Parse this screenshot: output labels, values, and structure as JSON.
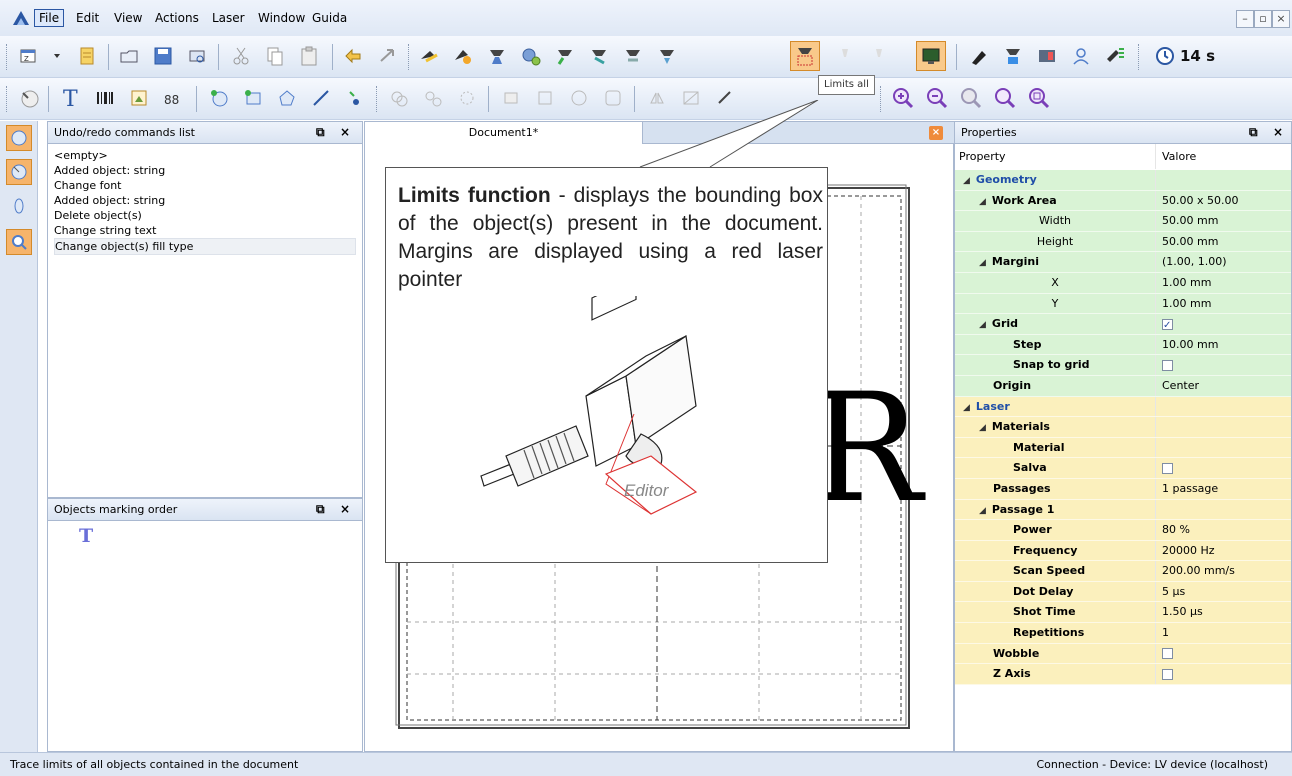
{
  "menu": {
    "items": [
      {
        "label": "File",
        "active": true
      },
      {
        "label": "Edit"
      },
      {
        "label": "View"
      },
      {
        "label": "Actions"
      },
      {
        "label": "Laser"
      },
      {
        "label": "Window"
      },
      {
        "label": "Guida"
      }
    ]
  },
  "toolbar": {
    "timer_label": "14 s",
    "tooltip": "Limits all"
  },
  "undo_panel": {
    "title": "Undo/redo commands list",
    "items": [
      "<empty>",
      "Added object: string",
      "Change font",
      "Added object: string",
      "Delete object(s)",
      "Change string text",
      "Change object(s) fill type"
    ]
  },
  "order_panel": {
    "title": "Objects marking order"
  },
  "document": {
    "tab_label": "Document1*",
    "canvas_letter": "R"
  },
  "callout": {
    "title": "Limits function",
    "text": " - displays the bounding box of the object(s) present in the document. Margins are displayed using a red laser pointer",
    "device_label": "Editor"
  },
  "properties": {
    "title": "Properties",
    "col_property": "Property",
    "col_value": "Valore",
    "rows": [
      {
        "indent": 0,
        "tri": true,
        "label": "Geometry",
        "value": "",
        "group": "geo",
        "style": "cat"
      },
      {
        "indent": 1,
        "tri": true,
        "label": "Work Area",
        "value": "50.00 x 50.00",
        "group": "geo",
        "style": "bold"
      },
      {
        "indent": 2,
        "tri": false,
        "label": "Width",
        "value": "50.00 mm",
        "group": "geo",
        "style": "center"
      },
      {
        "indent": 2,
        "tri": false,
        "label": "Height",
        "value": "50.00 mm",
        "group": "geo",
        "style": "center"
      },
      {
        "indent": 1,
        "tri": true,
        "label": "Margini",
        "value": "(1.00, 1.00)",
        "group": "geo",
        "style": "bold"
      },
      {
        "indent": 2,
        "tri": false,
        "label": "X",
        "value": "1.00 mm",
        "group": "geo",
        "style": "center"
      },
      {
        "indent": 2,
        "tri": false,
        "label": "Y",
        "value": "1.00 mm",
        "group": "geo",
        "style": "center"
      },
      {
        "indent": 1,
        "tri": true,
        "label": "Grid",
        "value": "",
        "check": true,
        "group": "geo",
        "style": "bold"
      },
      {
        "indent": 2,
        "tri": false,
        "label": "Step",
        "value": "10.00 mm",
        "group": "geo",
        "style": "bold"
      },
      {
        "indent": 2,
        "tri": false,
        "label": "Snap to grid",
        "value": "",
        "check": false,
        "group": "geo",
        "style": "bold"
      },
      {
        "indent": 1,
        "tri": false,
        "label": "Origin",
        "value": "Center",
        "group": "geo",
        "style": "bold"
      },
      {
        "indent": 0,
        "tri": true,
        "label": "Laser",
        "value": "",
        "group": "laser",
        "style": "cat"
      },
      {
        "indent": 1,
        "tri": true,
        "label": "Materials",
        "value": "",
        "group": "laser",
        "style": "bold"
      },
      {
        "indent": 2,
        "tri": false,
        "label": "Material",
        "value": "",
        "group": "laser",
        "style": "bold"
      },
      {
        "indent": 2,
        "tri": false,
        "label": "Salva",
        "value": "",
        "check": false,
        "group": "laser",
        "style": "bold"
      },
      {
        "indent": 1,
        "tri": false,
        "label": "Passages",
        "value": "1 passage",
        "group": "laser",
        "style": "bold"
      },
      {
        "indent": 1,
        "tri": true,
        "label": "Passage 1",
        "value": "",
        "group": "laser",
        "style": "bold"
      },
      {
        "indent": 2,
        "tri": false,
        "label": "Power",
        "value": "80 %",
        "group": "laser",
        "style": "bold"
      },
      {
        "indent": 2,
        "tri": false,
        "label": "Frequency",
        "value": "20000 Hz",
        "group": "laser",
        "style": "bold"
      },
      {
        "indent": 2,
        "tri": false,
        "label": "Scan Speed",
        "value": "200.00 mm/s",
        "group": "laser",
        "style": "bold"
      },
      {
        "indent": 2,
        "tri": false,
        "label": "Dot Delay",
        "value": "5 µs",
        "group": "laser",
        "style": "bold"
      },
      {
        "indent": 2,
        "tri": false,
        "label": "Shot Time",
        "value": "1.50 µs",
        "group": "laser",
        "style": "bold"
      },
      {
        "indent": 2,
        "tri": false,
        "label": "Repetitions",
        "value": "1",
        "group": "laser",
        "style": "bold"
      },
      {
        "indent": 1,
        "tri": false,
        "label": "Wobble",
        "value": "",
        "check": false,
        "group": "laser",
        "style": "bold"
      },
      {
        "indent": 1,
        "tri": false,
        "label": "Z Axis",
        "value": "",
        "check": false,
        "group": "laser",
        "style": "bold"
      }
    ]
  },
  "status": {
    "left": "Trace limits of all objects contained in the document",
    "right": "Connection - Device: LV device (localhost)"
  },
  "colors": {
    "accent": "#f6b46b",
    "geometry_bg": "#d9f3d5",
    "laser_bg": "#fbf0bd",
    "category_text": "#1f4ea8"
  }
}
